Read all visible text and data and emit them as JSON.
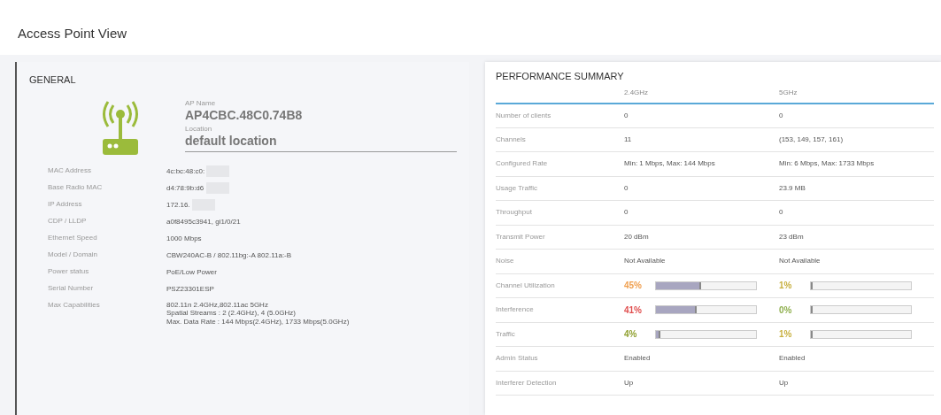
{
  "page_title": "Access Point View",
  "general": {
    "title": "GENERAL",
    "ap_name_label": "AP Name",
    "ap_name": "AP4CBC.48C0.74B8",
    "location_label": "Location",
    "location": "default location",
    "details": [
      {
        "label": "MAC Address",
        "lines": [
          "4c:bc:48:c0:"
        ],
        "redacted": true
      },
      {
        "label": "Base Radio MAC",
        "lines": [
          "d4:78:9b:d6"
        ],
        "redacted": true
      },
      {
        "label": "IP Address",
        "lines": [
          "172.16."
        ],
        "redacted": true
      },
      {
        "label": "CDP / LLDP",
        "lines": [
          "a0f8495c3941, gi1/0/21"
        ],
        "redacted": false
      },
      {
        "label": "Ethernet Speed",
        "lines": [
          "1000 Mbps"
        ],
        "redacted": false
      },
      {
        "label": "Model / Domain",
        "lines": [
          "CBW240AC-B / 802.11bg:-A 802.11a:-B"
        ],
        "redacted": false
      },
      {
        "label": "Power status",
        "lines": [
          "PoE/Low Power"
        ],
        "redacted": false
      },
      {
        "label": "Serial Number",
        "lines": [
          "PSZ23301ESP"
        ],
        "redacted": false
      },
      {
        "label": "Max Capabilities",
        "lines": [
          "802.11n 2.4GHz,802.11ac 5GHz",
          "Spatial Streams : 2 (2.4GHz), 4 (5.0GHz)",
          "Max. Data Rate : 144 Mbps(2.4GHz), 1733 Mbps(5.0GHz)"
        ],
        "redacted": false
      }
    ]
  },
  "performance": {
    "title": "PERFORMANCE SUMMARY",
    "columns": [
      "2.4GHz",
      "5GHz"
    ],
    "rows": [
      {
        "kind": "text",
        "label": "Number of clients",
        "values": [
          {
            "text": "0"
          },
          {
            "text": "0"
          }
        ]
      },
      {
        "kind": "text",
        "label": "Channels",
        "values": [
          {
            "text": "11"
          },
          {
            "text": "(153, 149, 157, 161)"
          }
        ]
      },
      {
        "kind": "text",
        "label": "Configured Rate",
        "values": [
          {
            "text": "Min: 1 Mbps, Max: 144 Mbps"
          },
          {
            "text": "Min: 6 Mbps, Max: 1733 Mbps"
          }
        ]
      },
      {
        "kind": "text",
        "label": "Usage Traffic",
        "values": [
          {
            "text": "0"
          },
          {
            "text": "23.9 MB"
          }
        ]
      },
      {
        "kind": "text",
        "label": "Throughput",
        "values": [
          {
            "text": "0"
          },
          {
            "text": "0"
          }
        ]
      },
      {
        "kind": "text",
        "label": "Transmit Power",
        "values": [
          {
            "text": "20 dBm"
          },
          {
            "text": "23 dBm"
          }
        ]
      },
      {
        "kind": "text",
        "label": "Noise",
        "values": [
          {
            "text": "Not Available"
          },
          {
            "text": "Not Available"
          }
        ]
      },
      {
        "kind": "meter",
        "label": "Channel Utilization",
        "values": [
          {
            "text": "45%",
            "color": "#f0a050",
            "level": 0.45
          },
          {
            "text": "1%",
            "color": "#c8b040",
            "level": 0.01
          }
        ]
      },
      {
        "kind": "meter",
        "label": "Interference",
        "values": [
          {
            "text": "41%",
            "color": "#e05050",
            "level": 0.41
          },
          {
            "text": "0%",
            "color": "#90b050",
            "level": 0
          }
        ]
      },
      {
        "kind": "meter",
        "label": "Traffic",
        "values": [
          {
            "text": "4%",
            "color": "#90a030",
            "level": 0.04
          },
          {
            "text": "1%",
            "color": "#c8b040",
            "level": 0.01
          }
        ]
      },
      {
        "kind": "text",
        "label": "Admin Status",
        "values": [
          {
            "text": "Enabled"
          },
          {
            "text": "Enabled"
          }
        ]
      },
      {
        "kind": "text",
        "label": "Interferer Detection",
        "values": [
          {
            "text": "Up"
          },
          {
            "text": "Up"
          }
        ]
      }
    ]
  }
}
